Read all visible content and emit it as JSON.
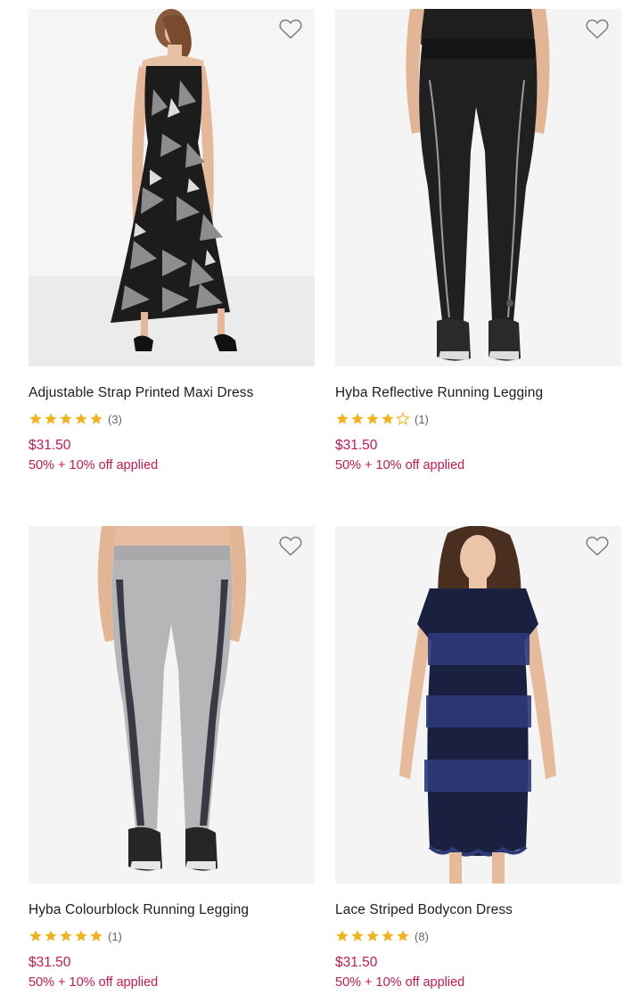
{
  "colors": {
    "accent_price": "#c8194f",
    "star_filled": "#f2b21d",
    "star_empty": "#b9b9b9",
    "image_bg": "#f3f3f3"
  },
  "products": [
    {
      "title": "Adjustable Strap Printed Maxi Dress",
      "rating": 5,
      "review_count": "(3)",
      "price": "$31.50",
      "discount": "50% + 10% off applied",
      "wishlist_icon": "heart-outline-icon"
    },
    {
      "title": "Hyba Reflective Running Legging",
      "rating": 4,
      "review_count": "(1)",
      "price": "$31.50",
      "discount": "50% + 10% off applied",
      "wishlist_icon": "heart-outline-icon"
    },
    {
      "title": "Hyba Colourblock Running Legging",
      "rating": 5,
      "review_count": "(1)",
      "price": "$31.50",
      "discount": "50% + 10% off applied",
      "wishlist_icon": "heart-outline-icon"
    },
    {
      "title": "Lace Striped Bodycon Dress",
      "rating": 5,
      "review_count": "(8)",
      "price": "$31.50",
      "discount": "50% + 10% off applied",
      "wishlist_icon": "heart-outline-icon"
    }
  ]
}
